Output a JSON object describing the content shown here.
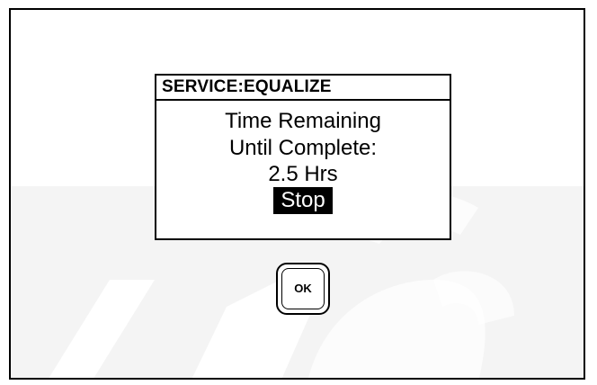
{
  "dialog": {
    "title": "SERVICE:EQUALIZE",
    "line1": "Time Remaining",
    "line2": "Until Complete:",
    "time_value": "2.5 Hrs",
    "stop_label": "Stop"
  },
  "keypad": {
    "ok_label": "OK"
  }
}
